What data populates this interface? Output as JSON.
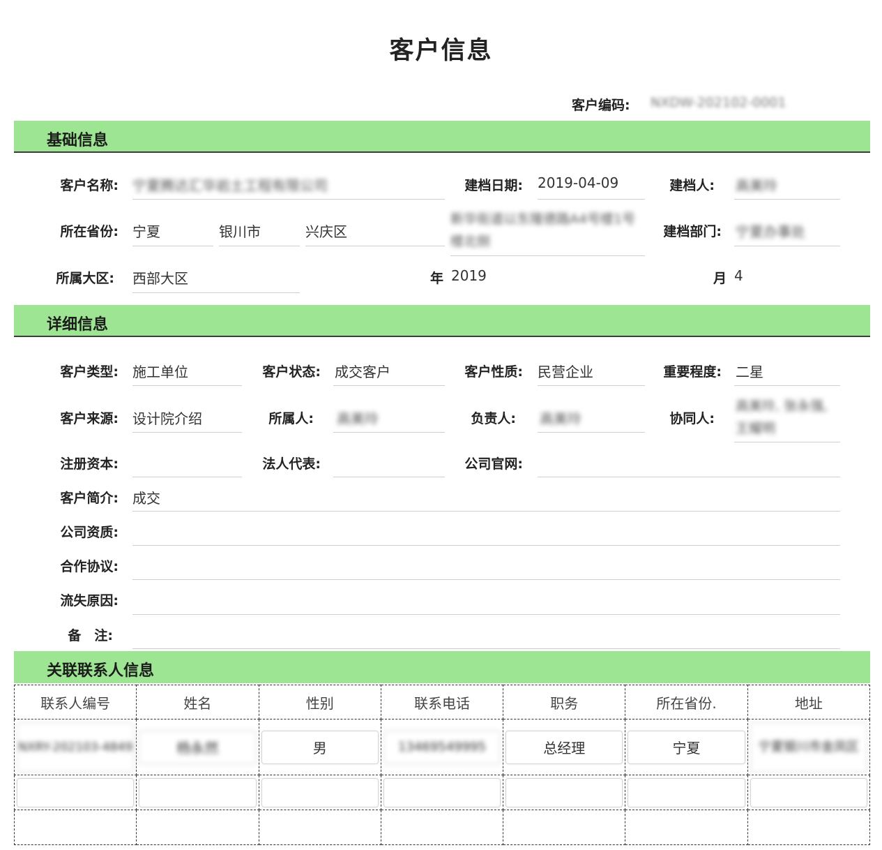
{
  "page": {
    "title": "客户信息",
    "code_label": "客户编码:",
    "code_value": "NXDW-202102-0001"
  },
  "sections": {
    "basic": "基础信息",
    "detail": "详细信息",
    "contacts": "关联联系人信息"
  },
  "basic": {
    "name_label": "客户名称:",
    "name_value": "宁夏腾达汇华岩土工程有限公司",
    "date_label": "建档日期:",
    "date_value": "2019-04-09",
    "creator_label": "建档人:",
    "creator_value": "高美玲",
    "province_label": "所在省份:",
    "province_value": "宁夏",
    "city_value": "银川市",
    "district_value": "兴庆区",
    "address_value": "新华街道以东隆德路A4号楼1号楼北侧",
    "dept_label": "建档部门:",
    "dept_value": "宁夏办事处",
    "region_label": "所属大区:",
    "region_value": "西部大区",
    "year_label": "年",
    "year_value": "2019",
    "month_label": "月",
    "month_value": "4"
  },
  "detail": {
    "type_label": "客户类型:",
    "type_value": "施工单位",
    "status_label": "客户状态:",
    "status_value": "成交客户",
    "nature_label": "客户性质:",
    "nature_value": "民营企业",
    "importance_label": "重要程度:",
    "importance_value": "二星",
    "source_label": "客户来源:",
    "source_value": "设计院介绍",
    "owner_label": "所属人:",
    "owner_value": "高美玲",
    "manager_label": "负责人:",
    "manager_value": "高美玲",
    "partner_label": "协同人:",
    "partner_value": "高美玲, 张永强, 王耀明",
    "capital_label": "注册资本:",
    "capital_value": "",
    "legal_label": "法人代表:",
    "legal_value": "",
    "website_label": "公司官网:",
    "website_value": "",
    "intro_label": "客户简介:",
    "intro_value": "成交",
    "qualification_label": "公司资质:",
    "qualification_value": "",
    "agreement_label": "合作协议:",
    "agreement_value": "",
    "loss_label": "流失原因:",
    "loss_value": "",
    "remark_label": "备　注:",
    "remark_value": ""
  },
  "contacts": {
    "headers": [
      "联系人编号",
      "姓名",
      "性别",
      "联系电话",
      "职务",
      "所在省份.",
      "地址"
    ],
    "rows": [
      [
        "NXRY-202103-4849",
        "杨永然",
        "男",
        "13469549995",
        "总经理",
        "宁夏",
        "宁夏银川市金凤区"
      ]
    ]
  }
}
